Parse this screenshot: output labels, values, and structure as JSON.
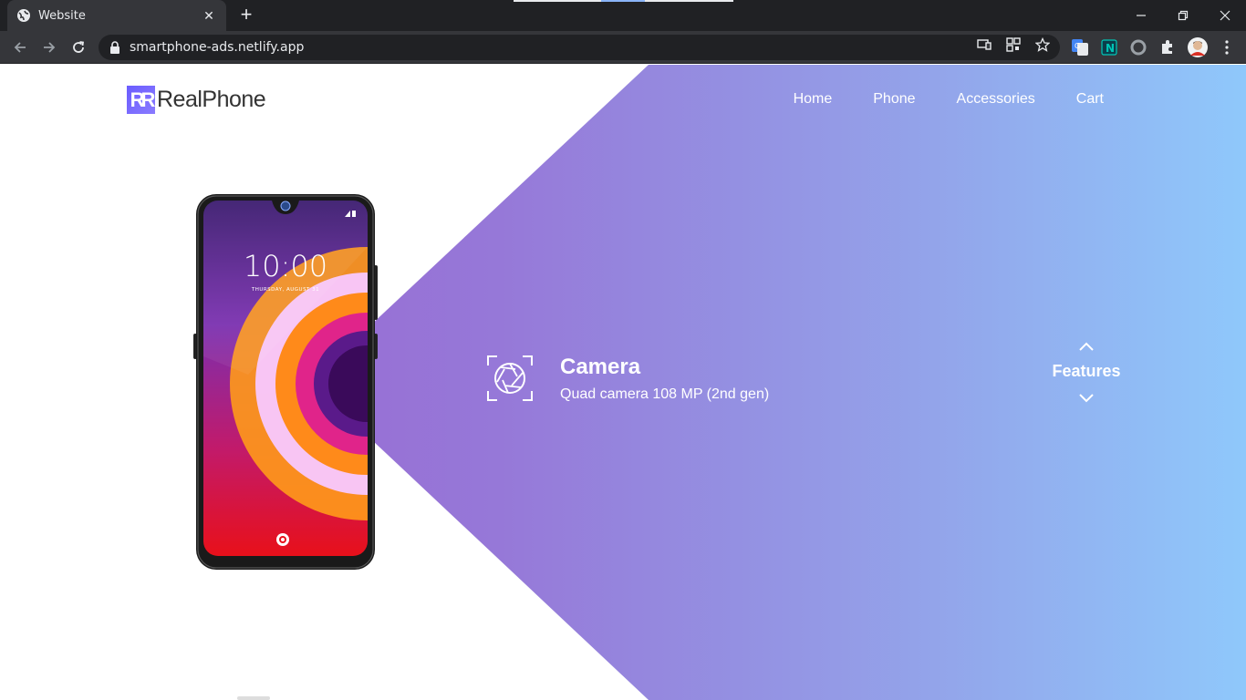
{
  "browser": {
    "tab_title": "Website",
    "url": "smartphone-ads.netlify.app"
  },
  "site": {
    "logo_mark": "RR",
    "logo_text": "RealPhone",
    "nav": [
      {
        "label": "Home"
      },
      {
        "label": "Phone"
      },
      {
        "label": "Accessories"
      },
      {
        "label": "Cart"
      }
    ]
  },
  "phone_screen": {
    "time": "10:00",
    "date": "THURSDAY, AUGUST 31"
  },
  "feature": {
    "title": "Camera",
    "description": "Quad camera 108 MP (2nd gen)",
    "switcher_label": "Features"
  },
  "colors": {
    "gradient_start": "#9b5fcf",
    "gradient_end": "#8fc8fb",
    "logo_accent": "#6a5cff"
  }
}
